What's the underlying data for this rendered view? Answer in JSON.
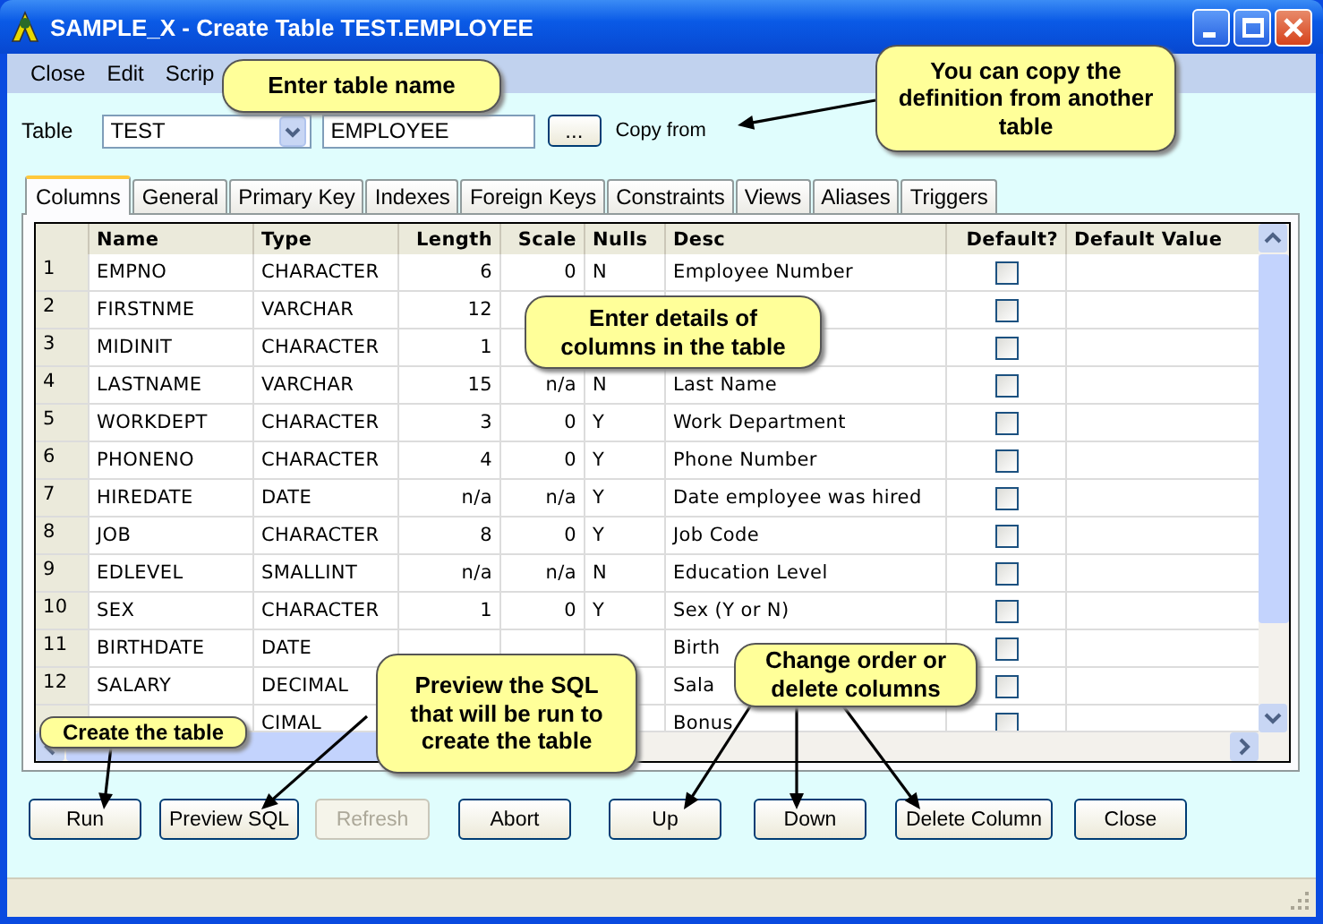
{
  "window": {
    "title": "SAMPLE_X - Create Table TEST.EMPLOYEE"
  },
  "menu": [
    "Close",
    "Edit",
    "Scrip"
  ],
  "table_form": {
    "label": "Table",
    "schema": "TEST",
    "name": "EMPLOYEE",
    "browse_button": "...",
    "copy_label": "Copy from"
  },
  "tabs": [
    {
      "label": "Columns",
      "selected": true
    },
    {
      "label": "General",
      "selected": false
    },
    {
      "label": "Primary Key",
      "selected": false
    },
    {
      "label": "Indexes",
      "selected": false
    },
    {
      "label": "Foreign Keys",
      "selected": false
    },
    {
      "label": "Constraints",
      "selected": false
    },
    {
      "label": "Views",
      "selected": false
    },
    {
      "label": "Aliases",
      "selected": false
    },
    {
      "label": "Triggers",
      "selected": false
    }
  ],
  "grid": {
    "columns": [
      "Name",
      "Type",
      "Length",
      "Scale",
      "Nulls",
      "Desc",
      "Default?",
      "Default Value"
    ],
    "rows": [
      {
        "num": "1",
        "name": "EMPNO",
        "type": "CHARACTER",
        "length": "6",
        "scale": "0",
        "nulls": "N",
        "desc": "Employee Number",
        "default": false
      },
      {
        "num": "2",
        "name": "FIRSTNME",
        "type": "VARCHAR",
        "length": "12",
        "default": false
      },
      {
        "num": "3",
        "name": "MIDINIT",
        "type": "CHARACTER",
        "length": "1",
        "default": false
      },
      {
        "num": "4",
        "name": "LASTNAME",
        "type": "VARCHAR",
        "length": "15",
        "scale": "n/a",
        "nulls": "N",
        "desc": "Last Name",
        "default": false
      },
      {
        "num": "5",
        "name": "WORKDEPT",
        "type": "CHARACTER",
        "length": "3",
        "scale": "0",
        "nulls": "Y",
        "desc": "Work Department",
        "default": false
      },
      {
        "num": "6",
        "name": "PHONENO",
        "type": "CHARACTER",
        "length": "4",
        "scale": "0",
        "nulls": "Y",
        "desc": "Phone Number",
        "default": false
      },
      {
        "num": "7",
        "name": "HIREDATE",
        "type": "DATE",
        "length": "n/a",
        "scale": "n/a",
        "nulls": "Y",
        "desc": "Date employee was hired",
        "default": false
      },
      {
        "num": "8",
        "name": "JOB",
        "type": "CHARACTER",
        "length": "8",
        "scale": "0",
        "nulls": "Y",
        "desc": "Job Code",
        "default": false
      },
      {
        "num": "9",
        "name": "EDLEVEL",
        "type": "SMALLINT",
        "length": "n/a",
        "scale": "n/a",
        "nulls": "N",
        "desc": "Education Level",
        "default": false
      },
      {
        "num": "10",
        "name": "SEX",
        "type": "CHARACTER",
        "length": "1",
        "scale": "0",
        "nulls": "Y",
        "desc": "Sex (Y or N)",
        "default": false
      },
      {
        "num": "11",
        "name": "BIRTHDATE",
        "type": "DATE",
        "desc": "Birth",
        "default": false
      },
      {
        "num": "12",
        "name": "SALARY",
        "type": "DECIMAL",
        "desc": "Sala",
        "default": false
      },
      {
        "type": "CIMAL",
        "desc": "Bonus",
        "default": false
      }
    ]
  },
  "buttons": [
    {
      "label": "Run",
      "disabled": false
    },
    {
      "label": "Preview SQL",
      "disabled": false
    },
    {
      "label": "Refresh",
      "disabled": true
    },
    {
      "label": "Abort",
      "disabled": false
    },
    {
      "label": "Up",
      "disabled": false
    },
    {
      "label": "Down",
      "disabled": false
    },
    {
      "label": "Delete Column",
      "disabled": false
    },
    {
      "label": "Close",
      "disabled": false
    }
  ],
  "callouts": [
    {
      "text": "Enter table name"
    },
    {
      "text": "You can copy the definition from another table"
    },
    {
      "text": "Enter details of columns in the table"
    },
    {
      "text": "Create the table"
    },
    {
      "text": "Preview the SQL that will be run to create the table"
    },
    {
      "text": "Change order or delete columns"
    }
  ]
}
